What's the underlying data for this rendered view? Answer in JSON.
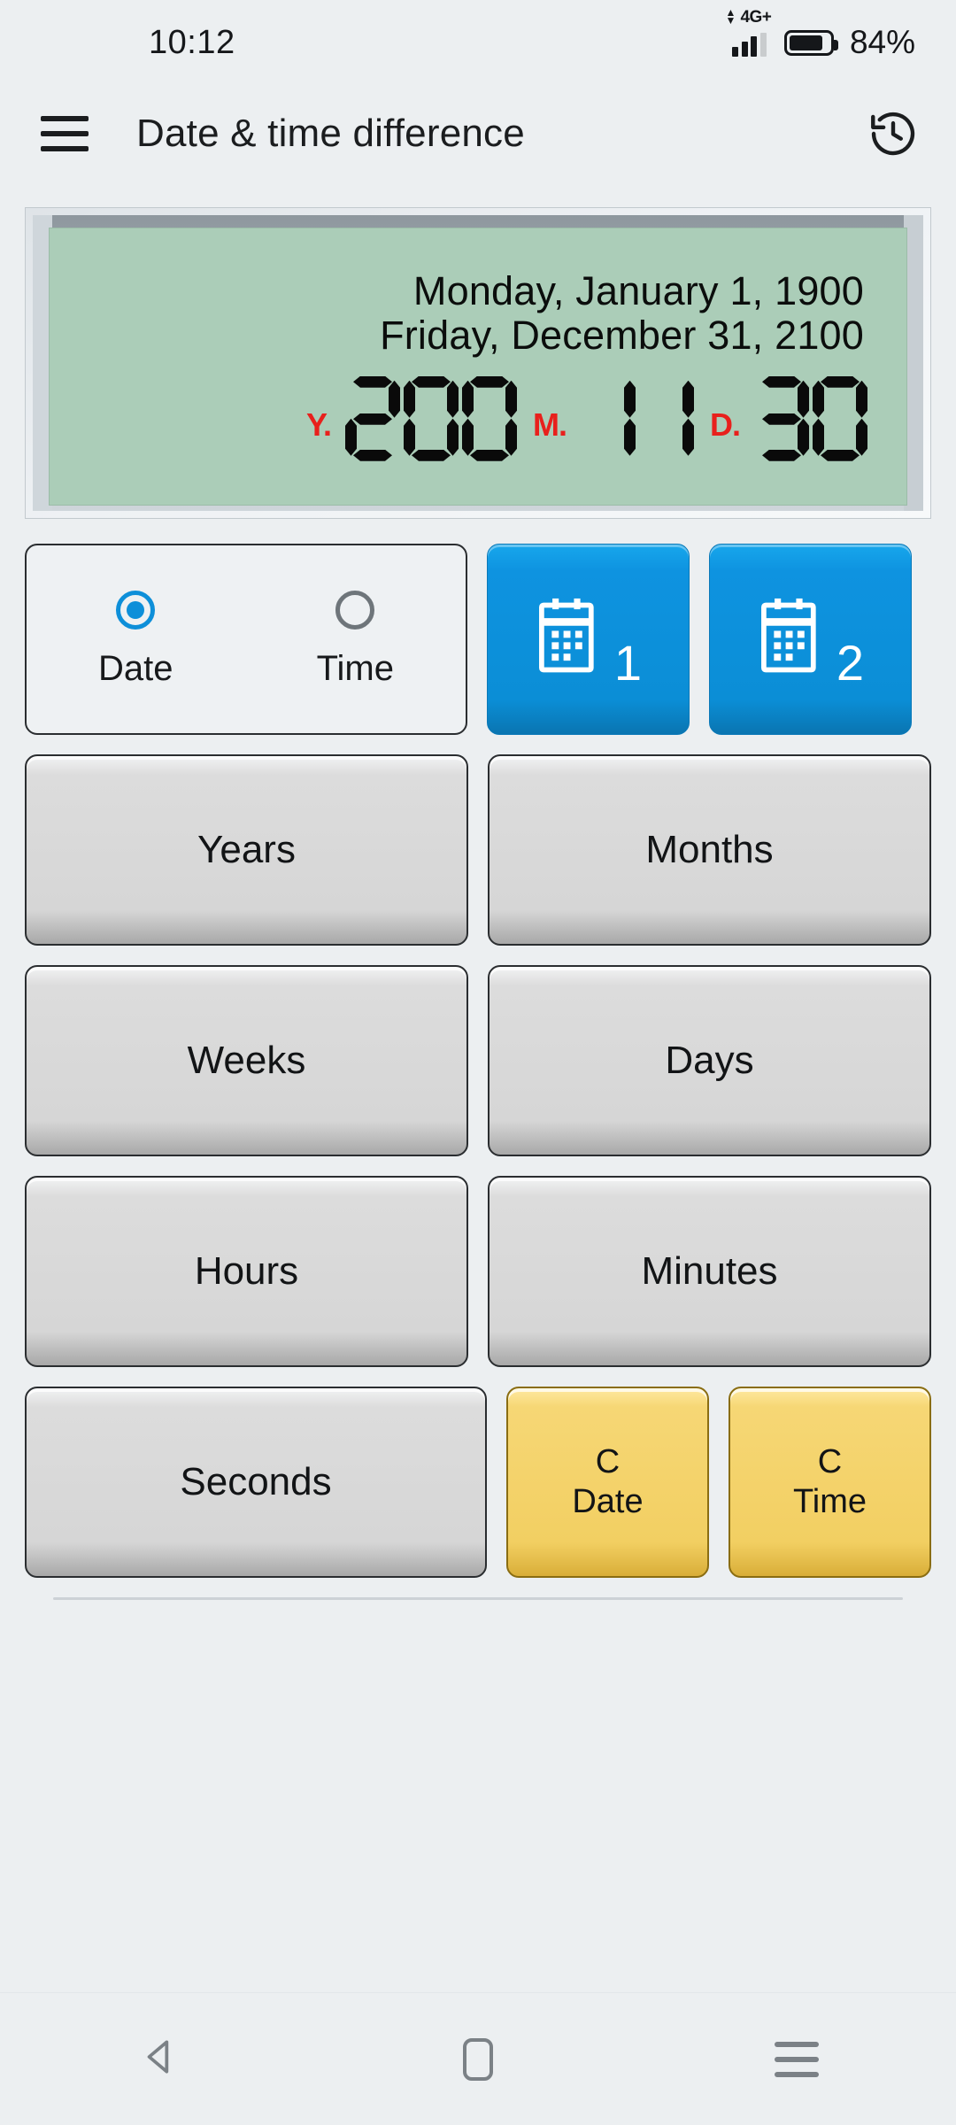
{
  "status_bar": {
    "time": "10:12",
    "network_label": "4G",
    "network_plus": "+",
    "battery_percent": "84%",
    "signal_icon": "signal-bars-icon",
    "battery_icon": "battery-icon",
    "data_arrows_icon": "data-transfer-arrows-icon"
  },
  "app_bar": {
    "menu_icon": "hamburger-menu-icon",
    "title": "Date & time difference",
    "history_icon": "history-clock-icon"
  },
  "display": {
    "date_line_1": "Monday, January 1, 1900",
    "date_line_2": "Friday, December 31, 2100",
    "segments": [
      {
        "unit": "Y.",
        "value": "200"
      },
      {
        "unit": "M.",
        "value": "11"
      },
      {
        "unit": "D.",
        "value": "30"
      }
    ],
    "screen_color": "#abcdb8",
    "unit_color": "#e8201c",
    "digit_color": "#0a0a0a"
  },
  "mode_selector": {
    "options": [
      {
        "label": "Date",
        "selected": true
      },
      {
        "label": "Time",
        "selected": false
      }
    ],
    "accent_color": "#0d8fd9"
  },
  "calendar_buttons": [
    {
      "icon": "calendar-icon",
      "number": "1",
      "color": "#0b8ed6"
    },
    {
      "icon": "calendar-icon",
      "number": "2",
      "color": "#0b8ed6"
    }
  ],
  "keypad": {
    "rows": [
      [
        {
          "label": "Years"
        },
        {
          "label": "Months"
        }
      ],
      [
        {
          "label": "Weeks"
        },
        {
          "label": "Days"
        }
      ],
      [
        {
          "label": "Hours"
        },
        {
          "label": "Minutes"
        }
      ]
    ],
    "last_row": {
      "seconds_label": "Seconds",
      "clear_date": {
        "line1": "C",
        "line2": "Date",
        "color": "#f2cf62"
      },
      "clear_time": {
        "line1": "C",
        "line2": "Time",
        "color": "#f2cf62"
      }
    }
  },
  "nav_bar": {
    "back_icon": "back-triangle-icon",
    "home_icon": "home-square-icon",
    "recents_icon": "recents-lines-icon"
  }
}
